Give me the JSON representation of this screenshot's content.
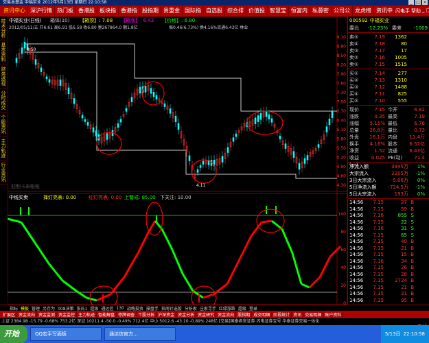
{
  "window": {
    "title": "交易本基金  中福实业 2012年5月13日 星期日 22:10:58"
  },
  "topmenu": [
    "资讯中心",
    "深沪行情",
    "热门板",
    "香港股",
    "板块指",
    "香港指",
    "股指期",
    "贵重金",
    "国际指",
    "自选股",
    "综合排",
    "价值投",
    "智慧宝",
    "恒富内",
    "私募密",
    "公司公",
    "龙虎榜",
    "资讯中"
  ],
  "topmenu_right": [
    "闪电手",
    "帮助",
    "_",
    "□",
    "×"
  ],
  "lefttabs": [
    "技术分析",
    "基本资料",
    "财务透视",
    "分时成交",
    "个股资讯",
    "主力轨迹",
    "行业资讯"
  ],
  "chart_header": {
    "stock": "中福实业(日线)",
    "mode": "箱体(10)",
    "ma_labels": [
      "【箱顶】: 7.08",
      "【箱底】: 6.43",
      "【价格】: 6.80"
    ],
    "date_line": "2012/05/11/五 开6.61 高6.91 低6.58 收6.80 量267864.0 额1.8亿",
    "extra": "振0.46(6.73%) 换4.16%流通6.43亿 林业",
    "price_hi_label": "9.50",
    "price_lo_label": "4.11",
    "watermark": "旧制卡来帐帐",
    "price_axis": [
      "9.10",
      "8.80",
      "8.50",
      "8.20",
      "7.90",
      "7.60",
      "7.30",
      "7.00",
      "6.70",
      "6.40",
      "6.10",
      "5.80",
      "5.50",
      "5.20",
      "4.90",
      "4.60",
      "4.30"
    ]
  },
  "indicator": {
    "name": "中线买卖",
    "items": [
      "择灯亮表: 0.00",
      "红灯亮表: 0.00",
      "上警戒: 85.00",
      "下关注: 10.00"
    ],
    "axis": [
      "100",
      "80",
      "60",
      "40",
      "20",
      "0"
    ]
  },
  "side": {
    "code": "000592",
    "name": "中福实业",
    "wei": {
      "label": "委比",
      "value": "-12.23%",
      "label2": "委差",
      "value2": "-1009"
    },
    "sell": [
      {
        "label": "卖⑤",
        "price": "7.19",
        "vol": "1362"
      },
      {
        "label": "卖④",
        "price": "7.18",
        "vol": "80"
      },
      {
        "label": "卖③",
        "price": "7.17",
        "vol": "17"
      },
      {
        "label": "卖②",
        "price": "7.16",
        "vol": "1005"
      },
      {
        "label": "卖①",
        "price": "7.15",
        "vol": "1515"
      }
    ],
    "buy": [
      {
        "label": "买①",
        "price": "7.14",
        "vol": "277"
      },
      {
        "label": "买②",
        "price": "7.13",
        "vol": "1310"
      },
      {
        "label": "买③",
        "price": "7.12",
        "vol": "1488"
      },
      {
        "label": "买④",
        "price": "7.11",
        "vol": "825"
      },
      {
        "label": "买⑤",
        "price": "7.10",
        "vol": "555"
      }
    ],
    "quote": [
      {
        "a": "现价",
        "b": "7.15",
        "c": "今开",
        "d": "6.82"
      },
      {
        "a": "涨跌",
        "b": "0.35",
        "c": "最高",
        "d": "7.19"
      },
      {
        "a": "涨幅",
        "b": "5.15%",
        "c": "最低",
        "d": "6.76"
      },
      {
        "a": "总量",
        "b": "26.8万",
        "c": "量比",
        "d": "0.73"
      },
      {
        "a": "外盘",
        "b": "16.1万",
        "c": "内盘",
        "d": "11.4万"
      },
      {
        "a": "换手",
        "b": "4.16%",
        "c": "股本",
        "d": "6.52亿"
      },
      {
        "a": "净资",
        "b": "1.52",
        "c": "流通",
        "d": "6.43亿"
      },
      {
        "a": "收益(一)",
        "b": "0.025",
        "c": "PE(动)",
        "d": "71.4"
      }
    ],
    "flow": [
      {
        "a": "净流入额",
        "b": "3945万",
        "c": "1%"
      },
      {
        "a": "大宗流入",
        "b": "2205万",
        "c": "-1%"
      },
      {
        "a": "3日大宗流入",
        "b": "-5.06万",
        "c": "0%"
      },
      {
        "a": "5日净流入额",
        "b": "-724.5万",
        "c": "-1%"
      },
      {
        "a": "5日大宗流入",
        "b": "193万",
        "c": "0%"
      }
    ],
    "ticks": [
      {
        "t": "14:56",
        "p": "7.15",
        "v": "27",
        "s": "B"
      },
      {
        "t": "14:56",
        "p": "7.15",
        "v": "59",
        "s": "B"
      },
      {
        "t": "14:56",
        "p": "7.16",
        "v": "855",
        "s": "S"
      },
      {
        "t": "14:56",
        "p": "7.15",
        "v": "22",
        "s": "S"
      },
      {
        "t": "14:56",
        "p": "7.16",
        "v": "31",
        "s": "S"
      },
      {
        "t": "14:56",
        "p": "7.15",
        "v": "65",
        "s": "S"
      },
      {
        "t": "14:56",
        "p": "7.15",
        "v": "40",
        "s": "B"
      },
      {
        "t": "14:56",
        "p": "7.15",
        "v": "21",
        "s": "B"
      },
      {
        "t": "14:56",
        "p": "7.15",
        "v": "15",
        "s": "B"
      },
      {
        "t": "14:56",
        "p": "7.16",
        "v": "34",
        "s": "B"
      },
      {
        "t": "14:56",
        "p": "7.15",
        "v": "26",
        "s": "B"
      },
      {
        "t": "14:56",
        "p": "7.15",
        "v": "28",
        "s": "B"
      },
      {
        "t": "14:56",
        "p": "7.15",
        "v": "2724",
        "s": "B"
      },
      {
        "t": "14:56",
        "p": "7.15",
        "v": "21",
        "s": "B"
      },
      {
        "t": "14:56",
        "p": "7.15",
        "v": "31",
        "s": "B"
      },
      {
        "t": "14:56",
        "p": "7.15",
        "v": "95",
        "s": "B"
      },
      {
        "t": "14:56",
        "p": "7.15",
        "v": "63",
        "s": "B"
      },
      {
        "t": "14:56",
        "p": "7.15",
        "v": "73",
        "s": "B"
      },
      {
        "t": "15:00",
        "p": "7.15",
        "v": "9472",
        "s": "B"
      }
    ],
    "ticks_footer": "日线"
  },
  "bottomtabs": [
    "指标",
    "模板",
    "管理",
    "另存为",
    "008决策",
    "张氏1",
    "超级",
    "通达信",
    "130",
    "战略投资",
    "操盘手",
    "指南针选股",
    "分析家",
    "庄家寻手",
    "红绿涨跌",
    "超级",
    "登录"
  ],
  "botmenu": [
    "扩展区",
    "资金流向",
    "资金监测",
    "资金监控",
    "主力轨迹",
    "智能解盘",
    "停牌调查",
    "个股分析",
    "沪深资金",
    "资金分析",
    "资金研究",
    "资金流向",
    "股指期",
    "成交明细",
    "阶段统计",
    "资讯",
    "交易明细",
    "账户资料"
  ],
  "status": "上证 2384.98 -15.79 -0.68% 753.2亿  深证 10211.4 -50.0 -0.49% 712.4亿  中小 5012.6 -43.10 -0.89% 248亿  [交易]国泰君安证券  闪电证券宝号  华泰证券交易一体化",
  "taskbar": {
    "start": "开始",
    "tasks": [
      "QQ宏手写面板",
      "通达信官方…"
    ],
    "tray": "5/13日",
    "clock": "22:10:58"
  },
  "colors": {
    "up": "#ff3030",
    "down": "#00ffff",
    "menu": "#b00000",
    "accent": "#ffff00"
  }
}
